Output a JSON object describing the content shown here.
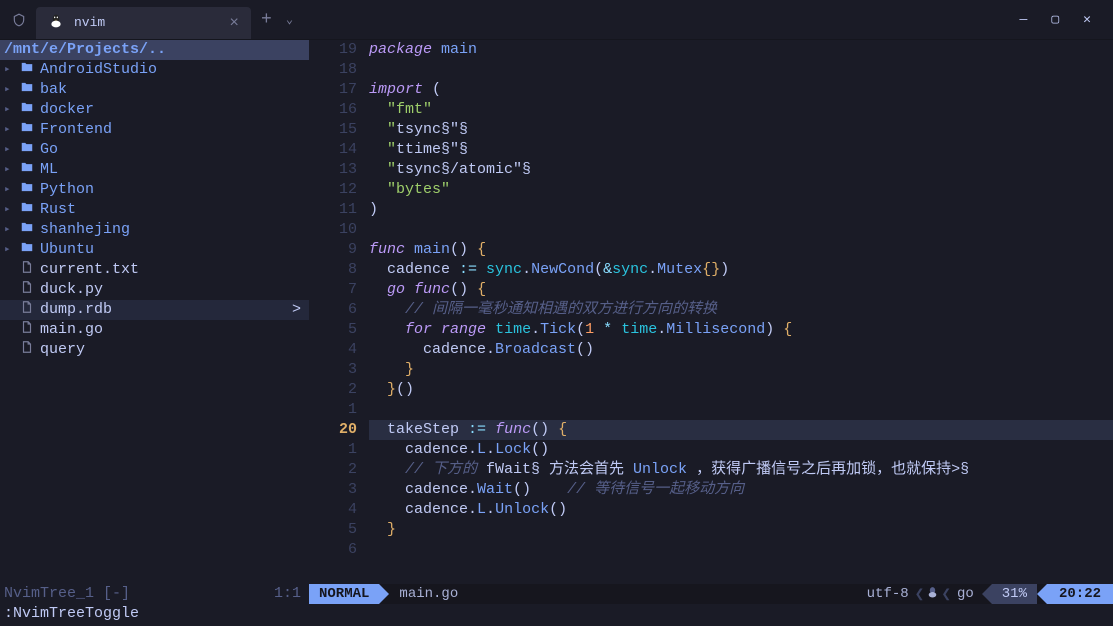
{
  "window": {
    "tab_title": "nvim"
  },
  "filetree": {
    "root": "/mnt/e/Projects/..",
    "folders": [
      "AndroidStudio",
      "bak",
      "docker",
      "Frontend",
      "Go",
      "ML",
      "Python",
      "Rust",
      "shanhejing",
      "Ubuntu"
    ],
    "files": [
      "current.txt",
      "duck.py",
      "dump.rdb",
      "main.go",
      "query"
    ],
    "selected_index": 2,
    "selected_mark": ">",
    "footer_left": "NvimTree_1  [-]",
    "footer_right": "1:1"
  },
  "code": {
    "lines": [
      {
        "n": "19",
        "t": "package main",
        "cls": ""
      },
      {
        "n": "18",
        "t": "",
        "cls": ""
      },
      {
        "n": "17",
        "t": "import (",
        "cls": ""
      },
      {
        "n": "16",
        "t": "  \"fmt\"",
        "cls": ""
      },
      {
        "n": "15",
        "t": "  \"sync\"",
        "cls": ""
      },
      {
        "n": "14",
        "t": "  \"time\"",
        "cls": ""
      },
      {
        "n": "13",
        "t": "  \"sync/atomic\"",
        "cls": ""
      },
      {
        "n": "12",
        "t": "  \"bytes\"",
        "cls": ""
      },
      {
        "n": "11",
        "t": ")",
        "cls": ""
      },
      {
        "n": "10",
        "t": "",
        "cls": ""
      },
      {
        "n": "9",
        "t": "func main() {",
        "cls": ""
      },
      {
        "n": "8",
        "t": "  cadence := sync.NewCond(&sync.Mutex{})",
        "cls": ""
      },
      {
        "n": "7",
        "t": "  go func() {",
        "cls": ""
      },
      {
        "n": "6",
        "t": "    // 间隔一毫秒通知相遇的双方进行方向的转换",
        "cls": ""
      },
      {
        "n": "5",
        "t": "    for range time.Tick(1 * time.Millisecond) {",
        "cls": ""
      },
      {
        "n": "4",
        "t": "      cadence.Broadcast()",
        "cls": ""
      },
      {
        "n": "3",
        "t": "    }",
        "cls": ""
      },
      {
        "n": "2",
        "t": "  }()",
        "cls": ""
      },
      {
        "n": "1",
        "t": "",
        "cls": ""
      },
      {
        "n": "20",
        "t": "  takeStep := func() {",
        "cls": "cursor-line"
      },
      {
        "n": "1",
        "t": "    cadence.L.Lock()",
        "cls": ""
      },
      {
        "n": "2",
        "t": "    // 下方的 Wait 方法会首先 Unlock ，获得广播信号之后再加锁，也就保持>",
        "cls": ""
      },
      {
        "n": "3",
        "t": "    cadence.Wait()    // 等待信号一起移动方向",
        "cls": ""
      },
      {
        "n": "4",
        "t": "    cadence.L.Unlock()",
        "cls": ""
      },
      {
        "n": "5",
        "t": "  }",
        "cls": ""
      },
      {
        "n": "6",
        "t": "",
        "cls": ""
      }
    ]
  },
  "status": {
    "mode": "NORMAL",
    "filename": "main.go",
    "encoding": "utf-8",
    "filetype": "go",
    "percent": "31%",
    "position": "20:22"
  },
  "cmdline": ":NvimTreeToggle"
}
